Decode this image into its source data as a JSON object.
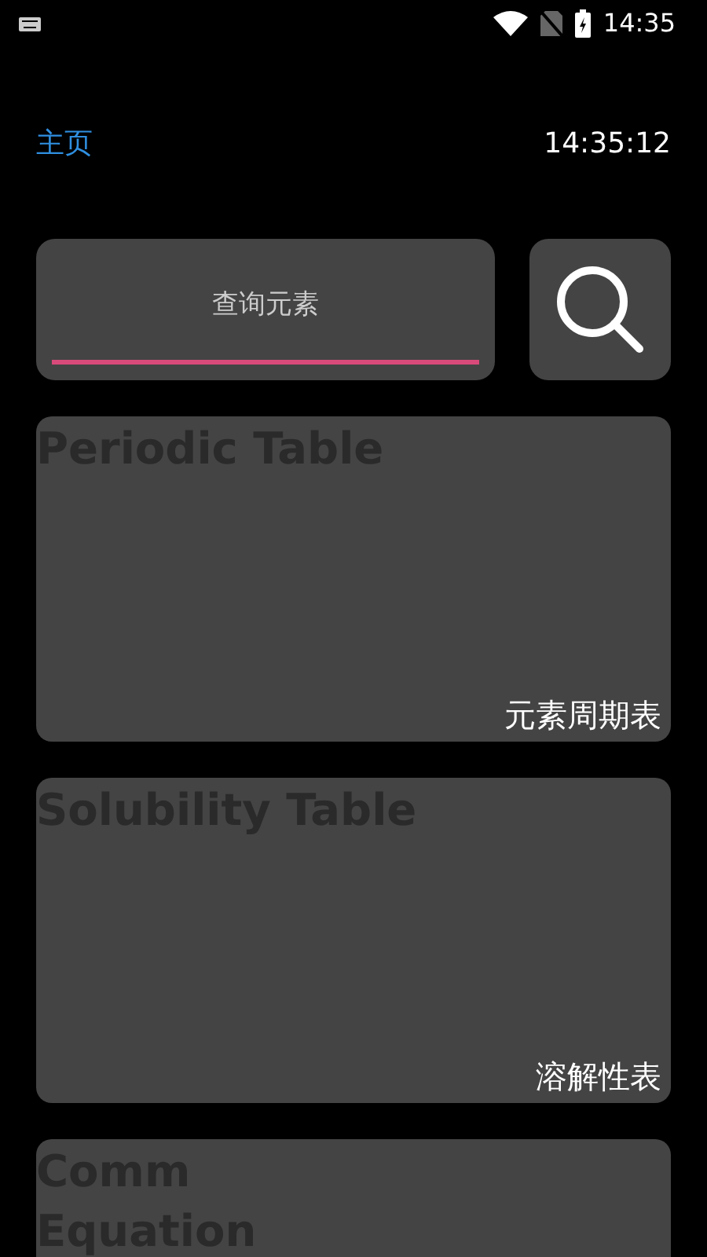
{
  "status_bar": {
    "time": "14:35"
  },
  "header": {
    "title": "主页",
    "clock": "14:35:12"
  },
  "search": {
    "placeholder": "查询元素"
  },
  "cards": [
    {
      "title_lines": [
        "Periodic Table"
      ],
      "label": "元素周期表"
    },
    {
      "title_lines": [
        "Solubility Table"
      ],
      "label": "溶解性表"
    },
    {
      "title_lines": [
        "Comm",
        "Equation"
      ]
    }
  ]
}
